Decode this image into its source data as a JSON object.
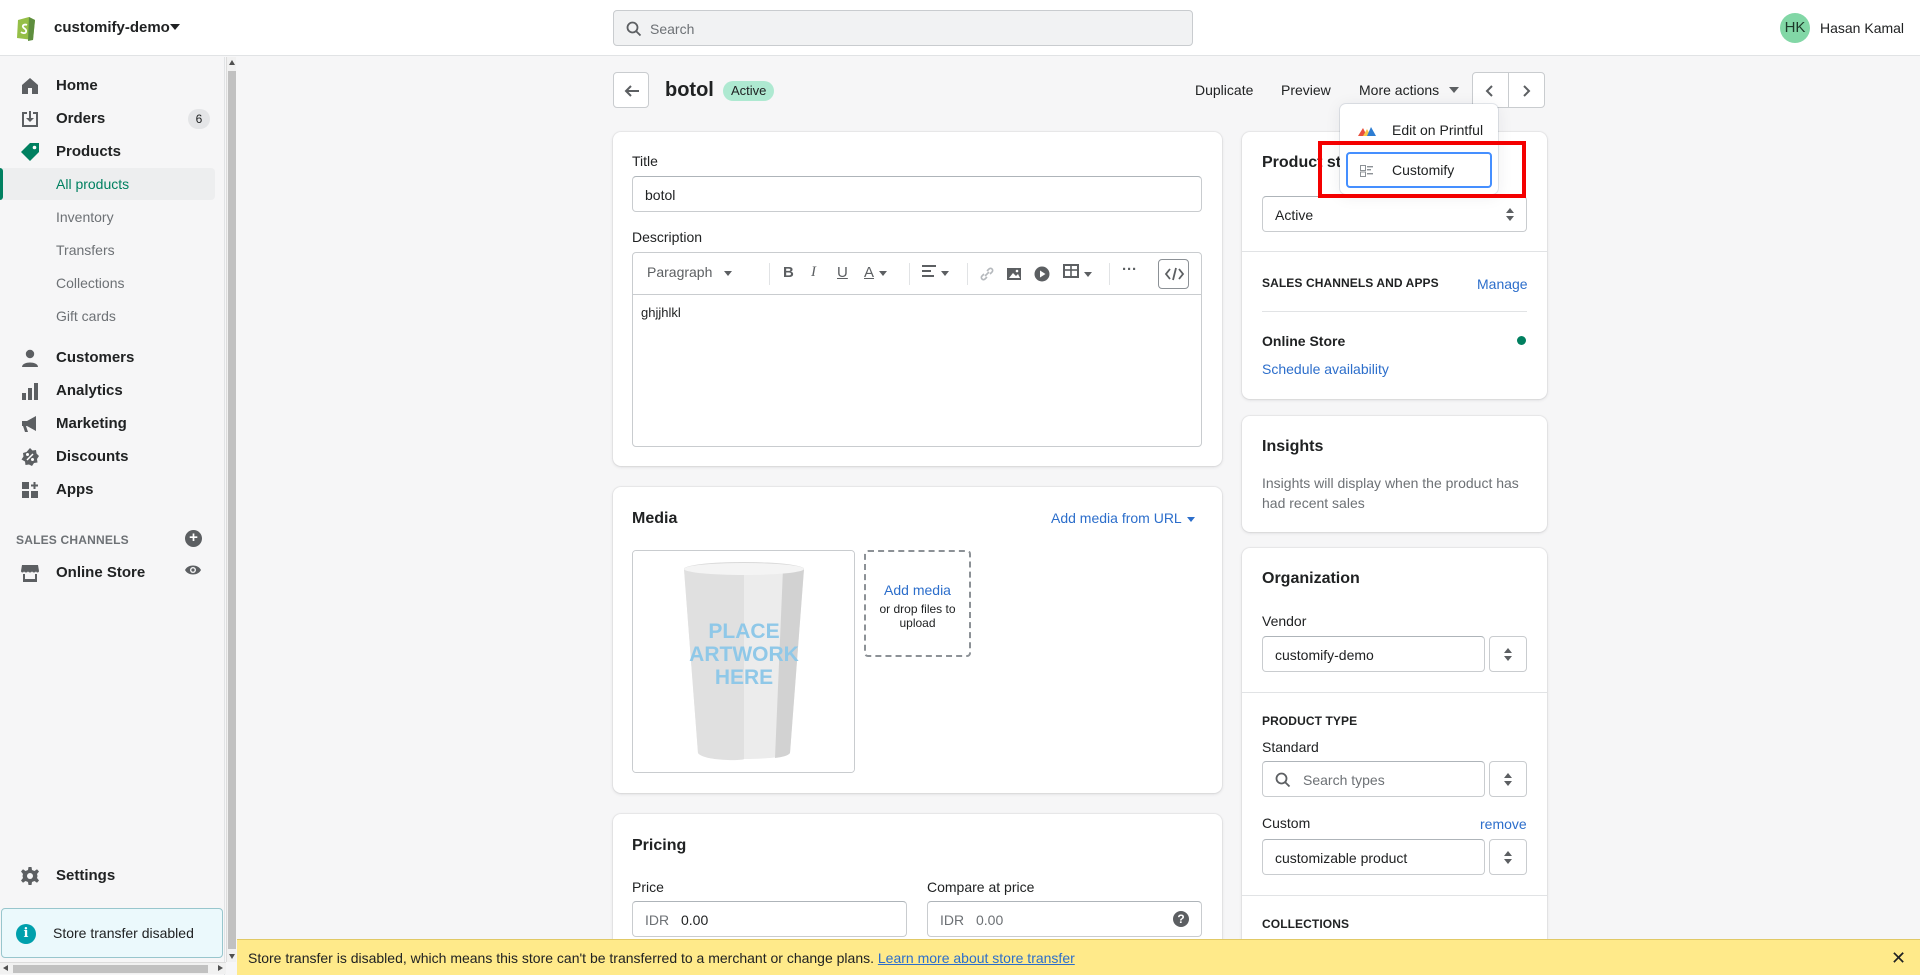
{
  "topbar": {
    "store_name": "customify-demo",
    "search_placeholder": "Search",
    "user_initials": "HK",
    "user_name": "Hasan Kamal"
  },
  "sidebar": {
    "items": [
      {
        "label": "Home",
        "icon": "home-icon"
      },
      {
        "label": "Orders",
        "icon": "orders-icon",
        "badge": "6"
      },
      {
        "label": "Products",
        "icon": "tag-icon"
      },
      {
        "label": "All products"
      },
      {
        "label": "Inventory"
      },
      {
        "label": "Transfers"
      },
      {
        "label": "Collections"
      },
      {
        "label": "Gift cards"
      },
      {
        "label": "Customers",
        "icon": "person-icon"
      },
      {
        "label": "Analytics",
        "icon": "bar-chart-icon"
      },
      {
        "label": "Marketing",
        "icon": "megaphone-icon"
      },
      {
        "label": "Discounts",
        "icon": "discount-icon"
      },
      {
        "label": "Apps",
        "icon": "apps-icon"
      }
    ],
    "sales_channels_title": "SALES CHANNELS",
    "online_store": "Online Store",
    "settings": "Settings",
    "store_transfer_notice": "Store transfer disabled"
  },
  "header": {
    "title": "botol",
    "status": "Active",
    "duplicate": "Duplicate",
    "preview": "Preview",
    "more_actions": "More actions"
  },
  "more_actions_menu": {
    "items": [
      "Edit on Printful",
      "Customify"
    ]
  },
  "product_form": {
    "title_label": "Title",
    "title_value": "botol",
    "description_label": "Description",
    "paragraph_select": "Paragraph",
    "description_text": "ghjjhlkl"
  },
  "media": {
    "title": "Media",
    "add_from_url": "Add media from URL",
    "add_media": "Add media",
    "drop_hint": "or drop files to upload",
    "image_text": [
      "PLACE",
      "ARTWORK",
      "HERE"
    ]
  },
  "pricing": {
    "title": "Pricing",
    "price_label": "Price",
    "price_currency": "IDR",
    "price_value": "0.00",
    "compare_label": "Compare at price",
    "compare_currency": "IDR",
    "compare_placeholder": "0.00"
  },
  "status_card": {
    "title": "Product status",
    "select_value": "Active",
    "sales_channels_title": "SALES CHANNELS AND APPS",
    "manage": "Manage",
    "online_store": "Online Store",
    "schedule": "Schedule availability"
  },
  "insights": {
    "title": "Insights",
    "text": "Insights will display when the product has had recent sales"
  },
  "organization": {
    "title": "Organization",
    "vendor_label": "Vendor",
    "vendor_value": "customify-demo",
    "product_type_title": "PRODUCT TYPE",
    "standard_label": "Standard",
    "standard_placeholder": "Search types",
    "custom_label": "Custom",
    "remove": "remove",
    "custom_value": "customizable product",
    "collections_title": "COLLECTIONS"
  },
  "banner": {
    "message": "Store transfer is disabled, which means this store can't be transferred to a merchant or change plans.",
    "link": "Learn more about store transfer"
  },
  "colors": {
    "accent_green": "#008060",
    "link_blue": "#2c6ecb",
    "banner_yellow": "#ffea8a",
    "highlight_red": "#f40000"
  }
}
